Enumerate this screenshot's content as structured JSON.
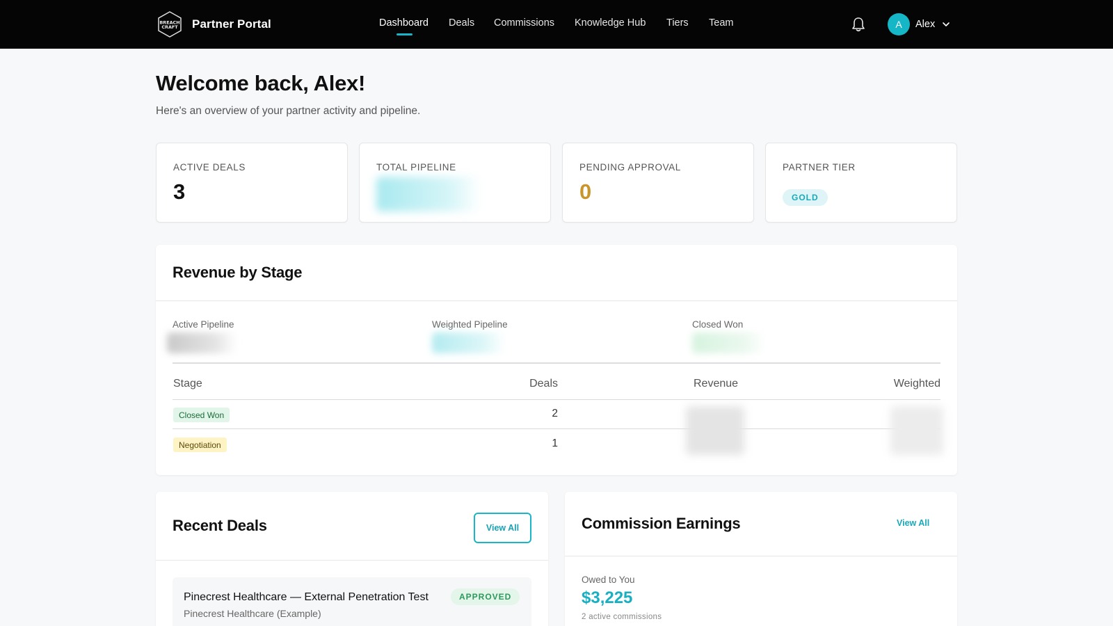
{
  "nav": {
    "brand": "Partner Portal",
    "links": [
      "Dashboard",
      "Deals",
      "Commissions",
      "Knowledge Hub",
      "Tiers",
      "Team"
    ],
    "active": "Dashboard",
    "user": {
      "initial": "A",
      "name": "Alex"
    }
  },
  "header": {
    "title": "Welcome back, Alex!",
    "subtitle": "Here's an overview of your partner activity and pipeline."
  },
  "stats": {
    "active_deals": {
      "label": "ACTIVE DEALS",
      "value": "3"
    },
    "total_pipeline": {
      "label": "TOTAL PIPELINE"
    },
    "pending_approval": {
      "label": "PENDING APPROVAL",
      "value": "0"
    },
    "partner_tier": {
      "label": "PARTNER TIER",
      "value": "GOLD"
    }
  },
  "revenue": {
    "title": "Revenue by Stage",
    "metrics": [
      "Active Pipeline",
      "Weighted Pipeline",
      "Closed Won"
    ],
    "columns": [
      "Stage",
      "Deals",
      "Revenue",
      "Weighted"
    ],
    "rows": [
      {
        "stage": "Closed Won",
        "deals": "2"
      },
      {
        "stage": "Negotiation",
        "deals": "1"
      }
    ]
  },
  "recent_deals": {
    "title": "Recent Deals",
    "view_all": "View All",
    "items": [
      {
        "title": "Pinecrest Healthcare — External Penetration Test",
        "client": "Pinecrest Healthcare (Example)",
        "status": "APPROVED"
      }
    ]
  },
  "commission": {
    "title": "Commission Earnings",
    "view_all": "View All",
    "owed_label": "Owed to You",
    "owed_amount": "$3,225",
    "owed_sub": "2 active commissions"
  },
  "colors": {
    "accent": "#19b5c8",
    "nav_bg": "#050505",
    "gold": "#c8962a",
    "won_badge": "#e1f5e8",
    "negotiation_badge": "#fdf3c4"
  }
}
